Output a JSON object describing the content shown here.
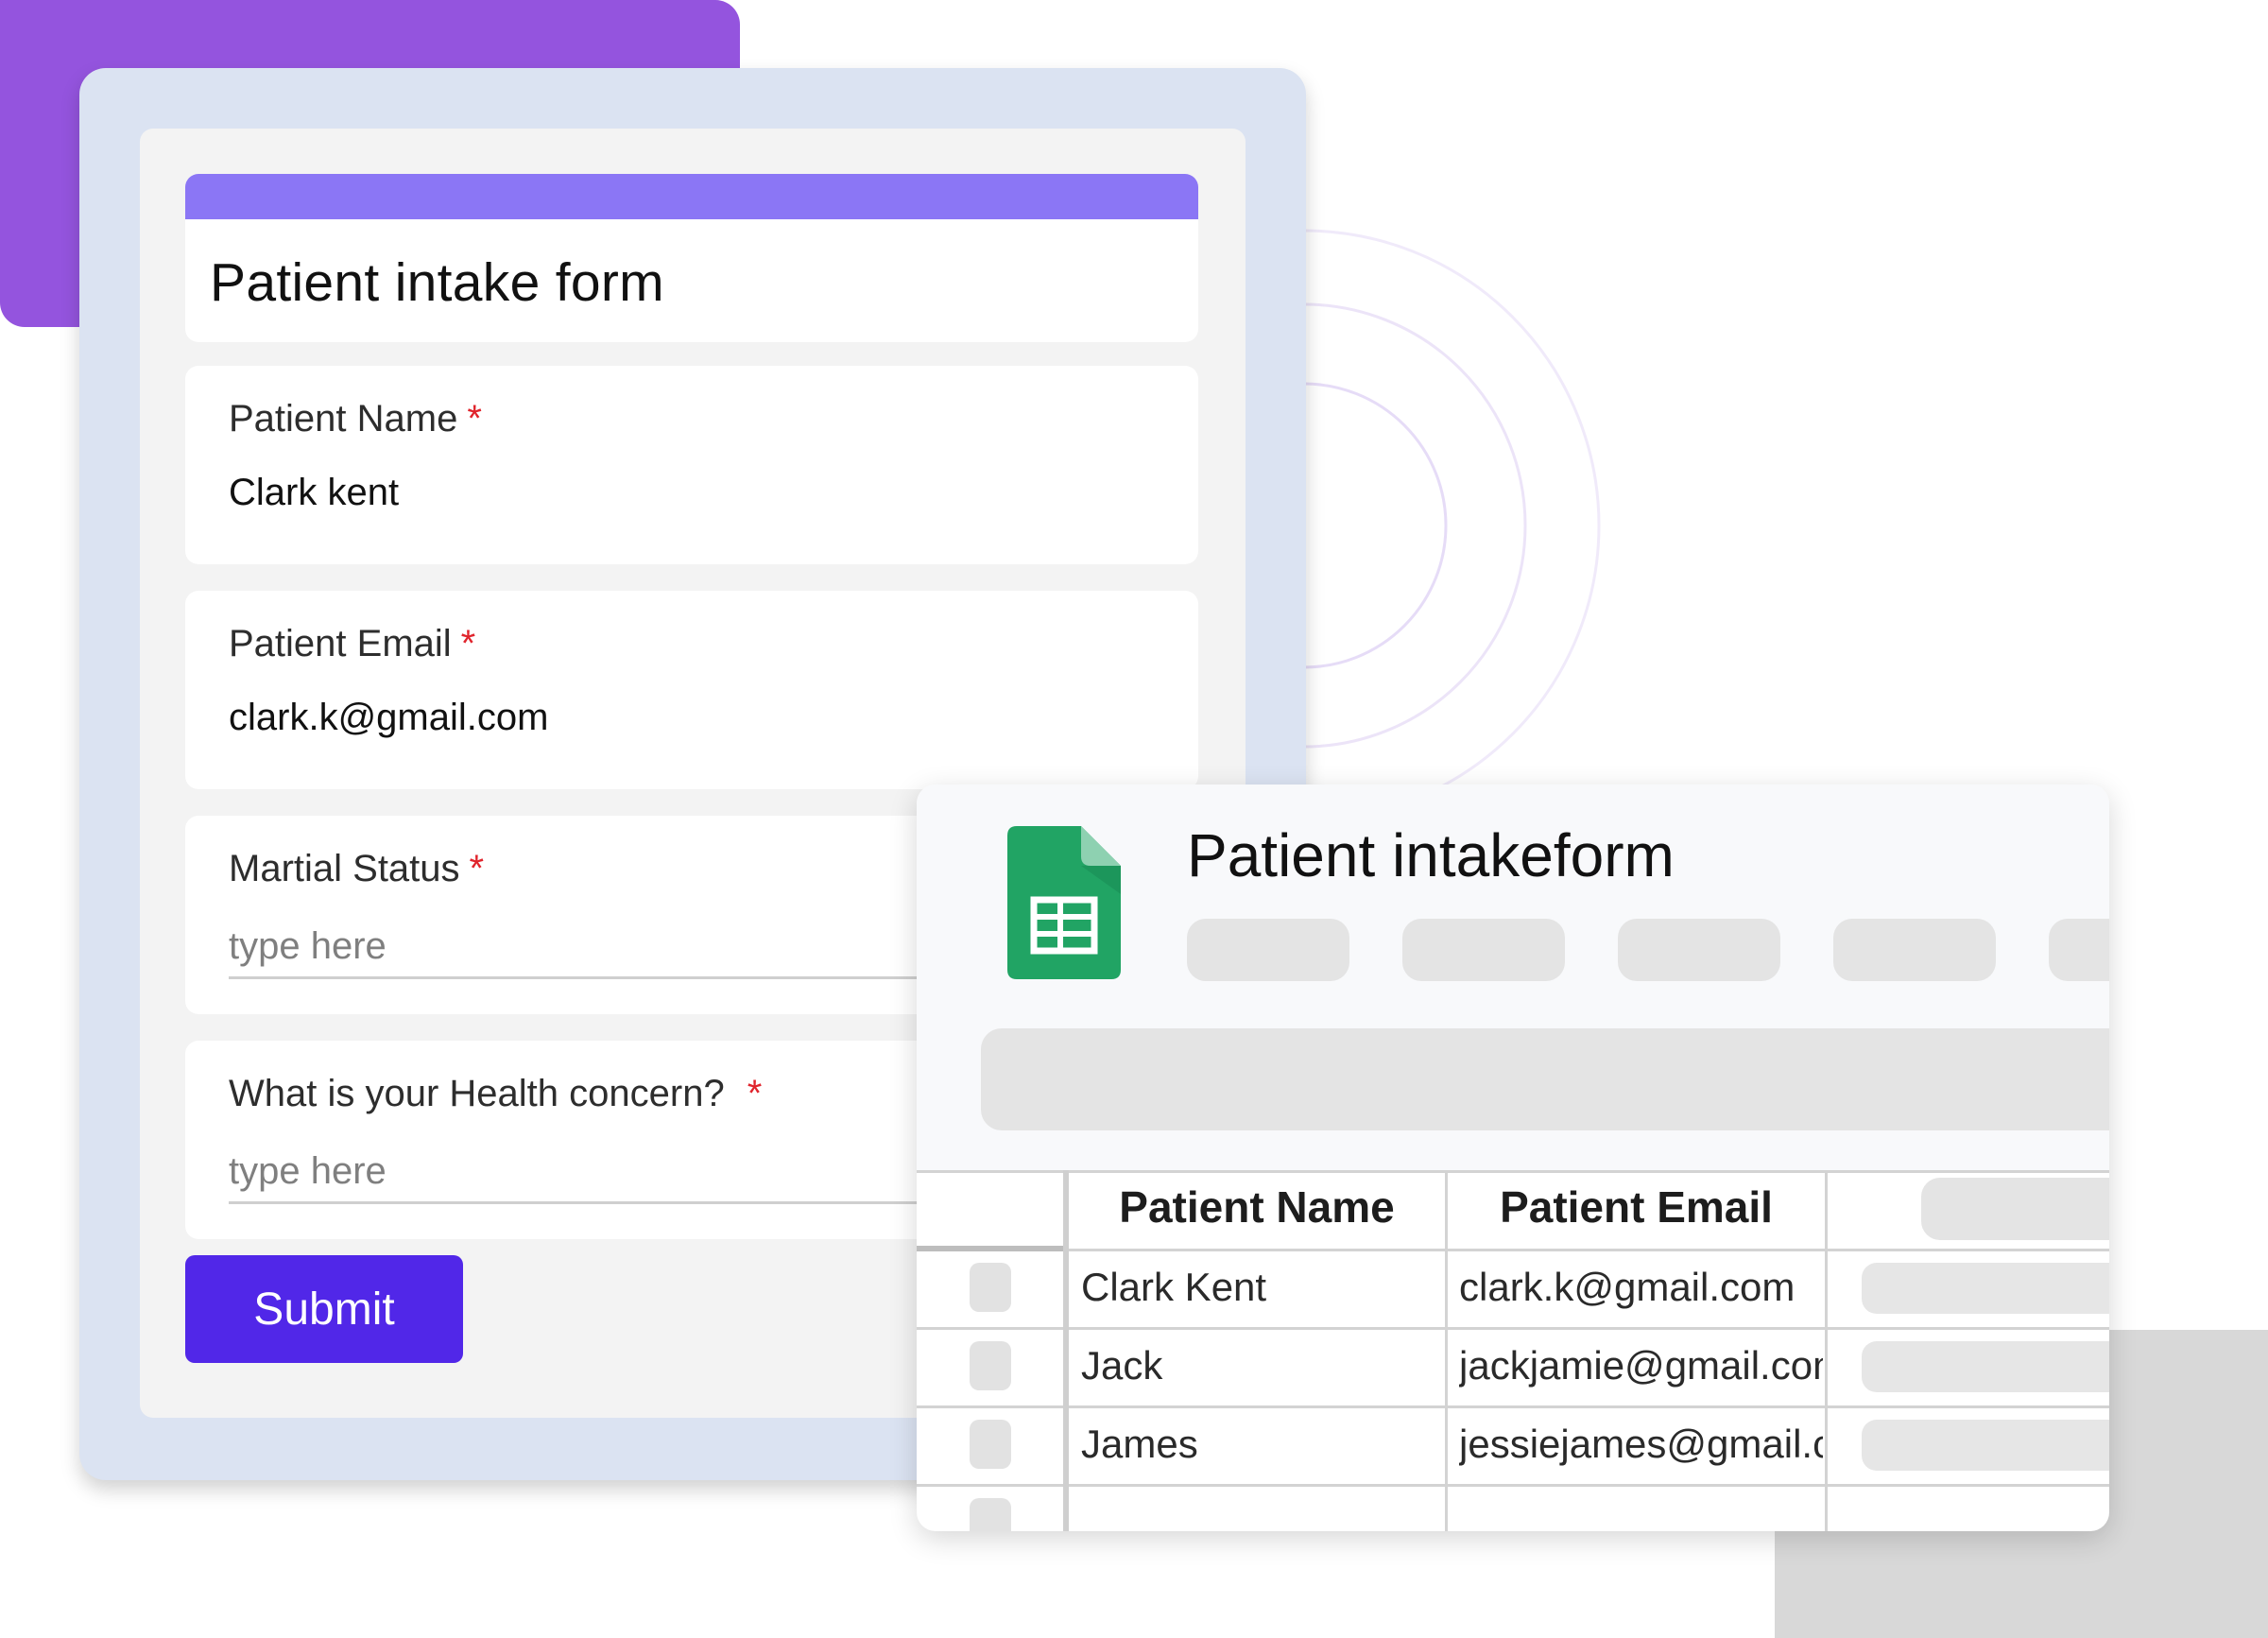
{
  "form": {
    "title": "Patient intake form",
    "required_marker": "*",
    "fields": [
      {
        "label": "Patient Name",
        "value": "Clark kent"
      },
      {
        "label": "Patient Email",
        "value": "clark.k@gmail.com"
      },
      {
        "label": "Martial Status",
        "placeholder": "type here"
      },
      {
        "label": "What is your Health concern?",
        "placeholder": "type here"
      }
    ],
    "submit_label": "Submit"
  },
  "sheet": {
    "title": "Patient intakeform",
    "icon": "google-sheets-icon",
    "columns": [
      "Patient Name",
      "Patient Email"
    ],
    "rows": [
      {
        "name": "Clark Kent",
        "email": "clark.k@gmail.com"
      },
      {
        "name": "Jack",
        "email": "jackjamie@gmail.com"
      },
      {
        "name": "James",
        "email": "jessiejames@gmail.com"
      }
    ]
  },
  "colors": {
    "form_accent": "#8b76f5",
    "submit": "#5127e8",
    "required": "#e0242c",
    "sheets_green": "#21a464",
    "deco_purple": "#9454de"
  }
}
